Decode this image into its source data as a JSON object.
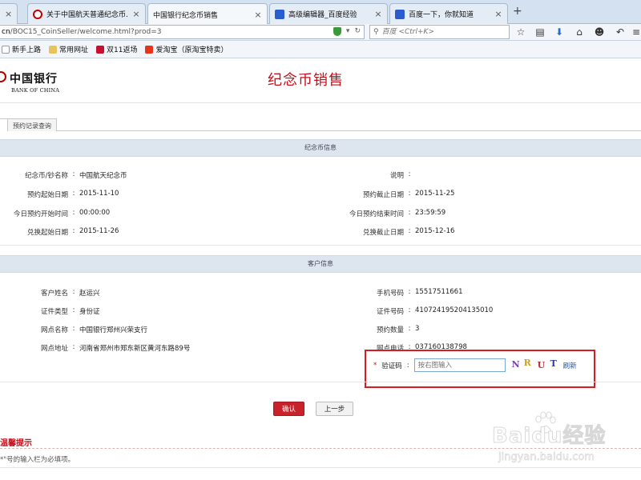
{
  "browser": {
    "tabs": [
      {
        "label": "关于中国航天普通纪念币...",
        "favicon": "boc-icon",
        "active": false
      },
      {
        "label": "中国银行纪念币销售",
        "favicon": "none",
        "active": true
      },
      {
        "label": "高级编辑器_百度经验",
        "favicon": "baidu-paw-icon",
        "active": false
      },
      {
        "label": "百度一下，你就知道",
        "favicon": "baidu-paw-icon",
        "active": false
      }
    ],
    "address_host": "cn",
    "address_path": "/BOC15_CoinSeller/welcome.html?prod=3",
    "search_placeholder": "百度 <Ctrl+K>",
    "bookmarks": [
      {
        "label": "新手上路",
        "icon": "page-icon"
      },
      {
        "label": "常用网址",
        "icon": "folder-icon"
      },
      {
        "label": "双11返场",
        "icon": "tmall-icon"
      },
      {
        "label": "爱淘宝（原淘宝特卖）",
        "icon": "aitaobao-icon"
      }
    ]
  },
  "header": {
    "logo_cn": "中国银行",
    "logo_en": "BANK OF CHINA",
    "title": "纪念币销售"
  },
  "subtabs": [
    "",
    "预约记录查询"
  ],
  "coin_section": {
    "title": "纪念币信息",
    "left": [
      {
        "k": "纪念币/钞名称",
        "v": "中国航天纪念币"
      },
      {
        "k": "预约起始日期",
        "v": "2015-11-10"
      },
      {
        "k": "今日预约开始时间",
        "v": "00:00:00"
      },
      {
        "k": "兑换起始日期",
        "v": "2015-11-26"
      }
    ],
    "right": [
      {
        "k": "说明",
        "v": ""
      },
      {
        "k": "预约截止日期",
        "v": "2015-11-25"
      },
      {
        "k": "今日预约结束时间",
        "v": "23:59:59"
      },
      {
        "k": "兑换截止日期",
        "v": "2015-12-16"
      }
    ]
  },
  "customer_section": {
    "title": "客户信息",
    "left": [
      {
        "k": "客户姓名",
        "v": "赵运兴"
      },
      {
        "k": "证件类型",
        "v": "身份证"
      },
      {
        "k": "网点名称",
        "v": "中国银行郑州兴荣支行"
      },
      {
        "k": "网点地址",
        "v": "河南省郑州市郑东新区黄河东路89号"
      }
    ],
    "right": [
      {
        "k": "手机号码",
        "v": "15517511661"
      },
      {
        "k": "证件号码",
        "v": "410724195204135010"
      },
      {
        "k": "预约数量",
        "v": "3"
      },
      {
        "k": "网点电话",
        "v": "037160138798"
      }
    ]
  },
  "captcha": {
    "required_mark": "*",
    "label": "验证码",
    "placeholder": "按右图输入",
    "chars": [
      "N",
      "R",
      "U",
      "T"
    ],
    "refresh_label": "刷新"
  },
  "actions": {
    "confirm_label": "确认",
    "prev_label": "上一步"
  },
  "notice": {
    "title": "温馨提示",
    "text": "*\"号的输入栏为必填项。"
  },
  "watermark": {
    "main": "Baidu经验",
    "url": "jingyan.baidu.com"
  },
  "colors": {
    "accent_red": "#c40f1b",
    "section_bg": "#dde6ef",
    "highlight_border": "#d91c22"
  }
}
